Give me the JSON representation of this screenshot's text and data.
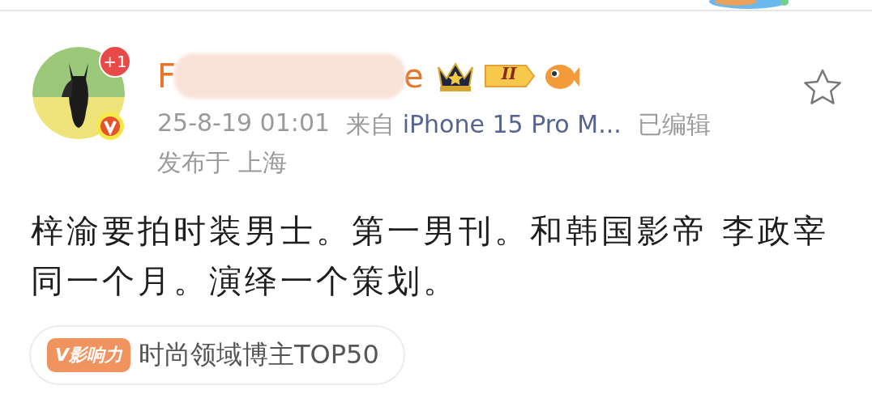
{
  "author": {
    "name_start": "F",
    "name_end": "e",
    "notification_badge": "+1",
    "verified": true,
    "level_badge": "II",
    "favorited": false
  },
  "meta": {
    "time": "25-8-19 01:01",
    "source_prefix": "来自",
    "source": "iPhone 15 Pro M...",
    "edited": "已编辑",
    "location": "发布于 上海"
  },
  "content": "梓渝要拍时装男士。第一男刊。和韩国影帝 李政宰同一个月。演绎一个策划。",
  "tag": {
    "badge": "V影响力",
    "label": "时尚领域博主TOP50"
  }
}
